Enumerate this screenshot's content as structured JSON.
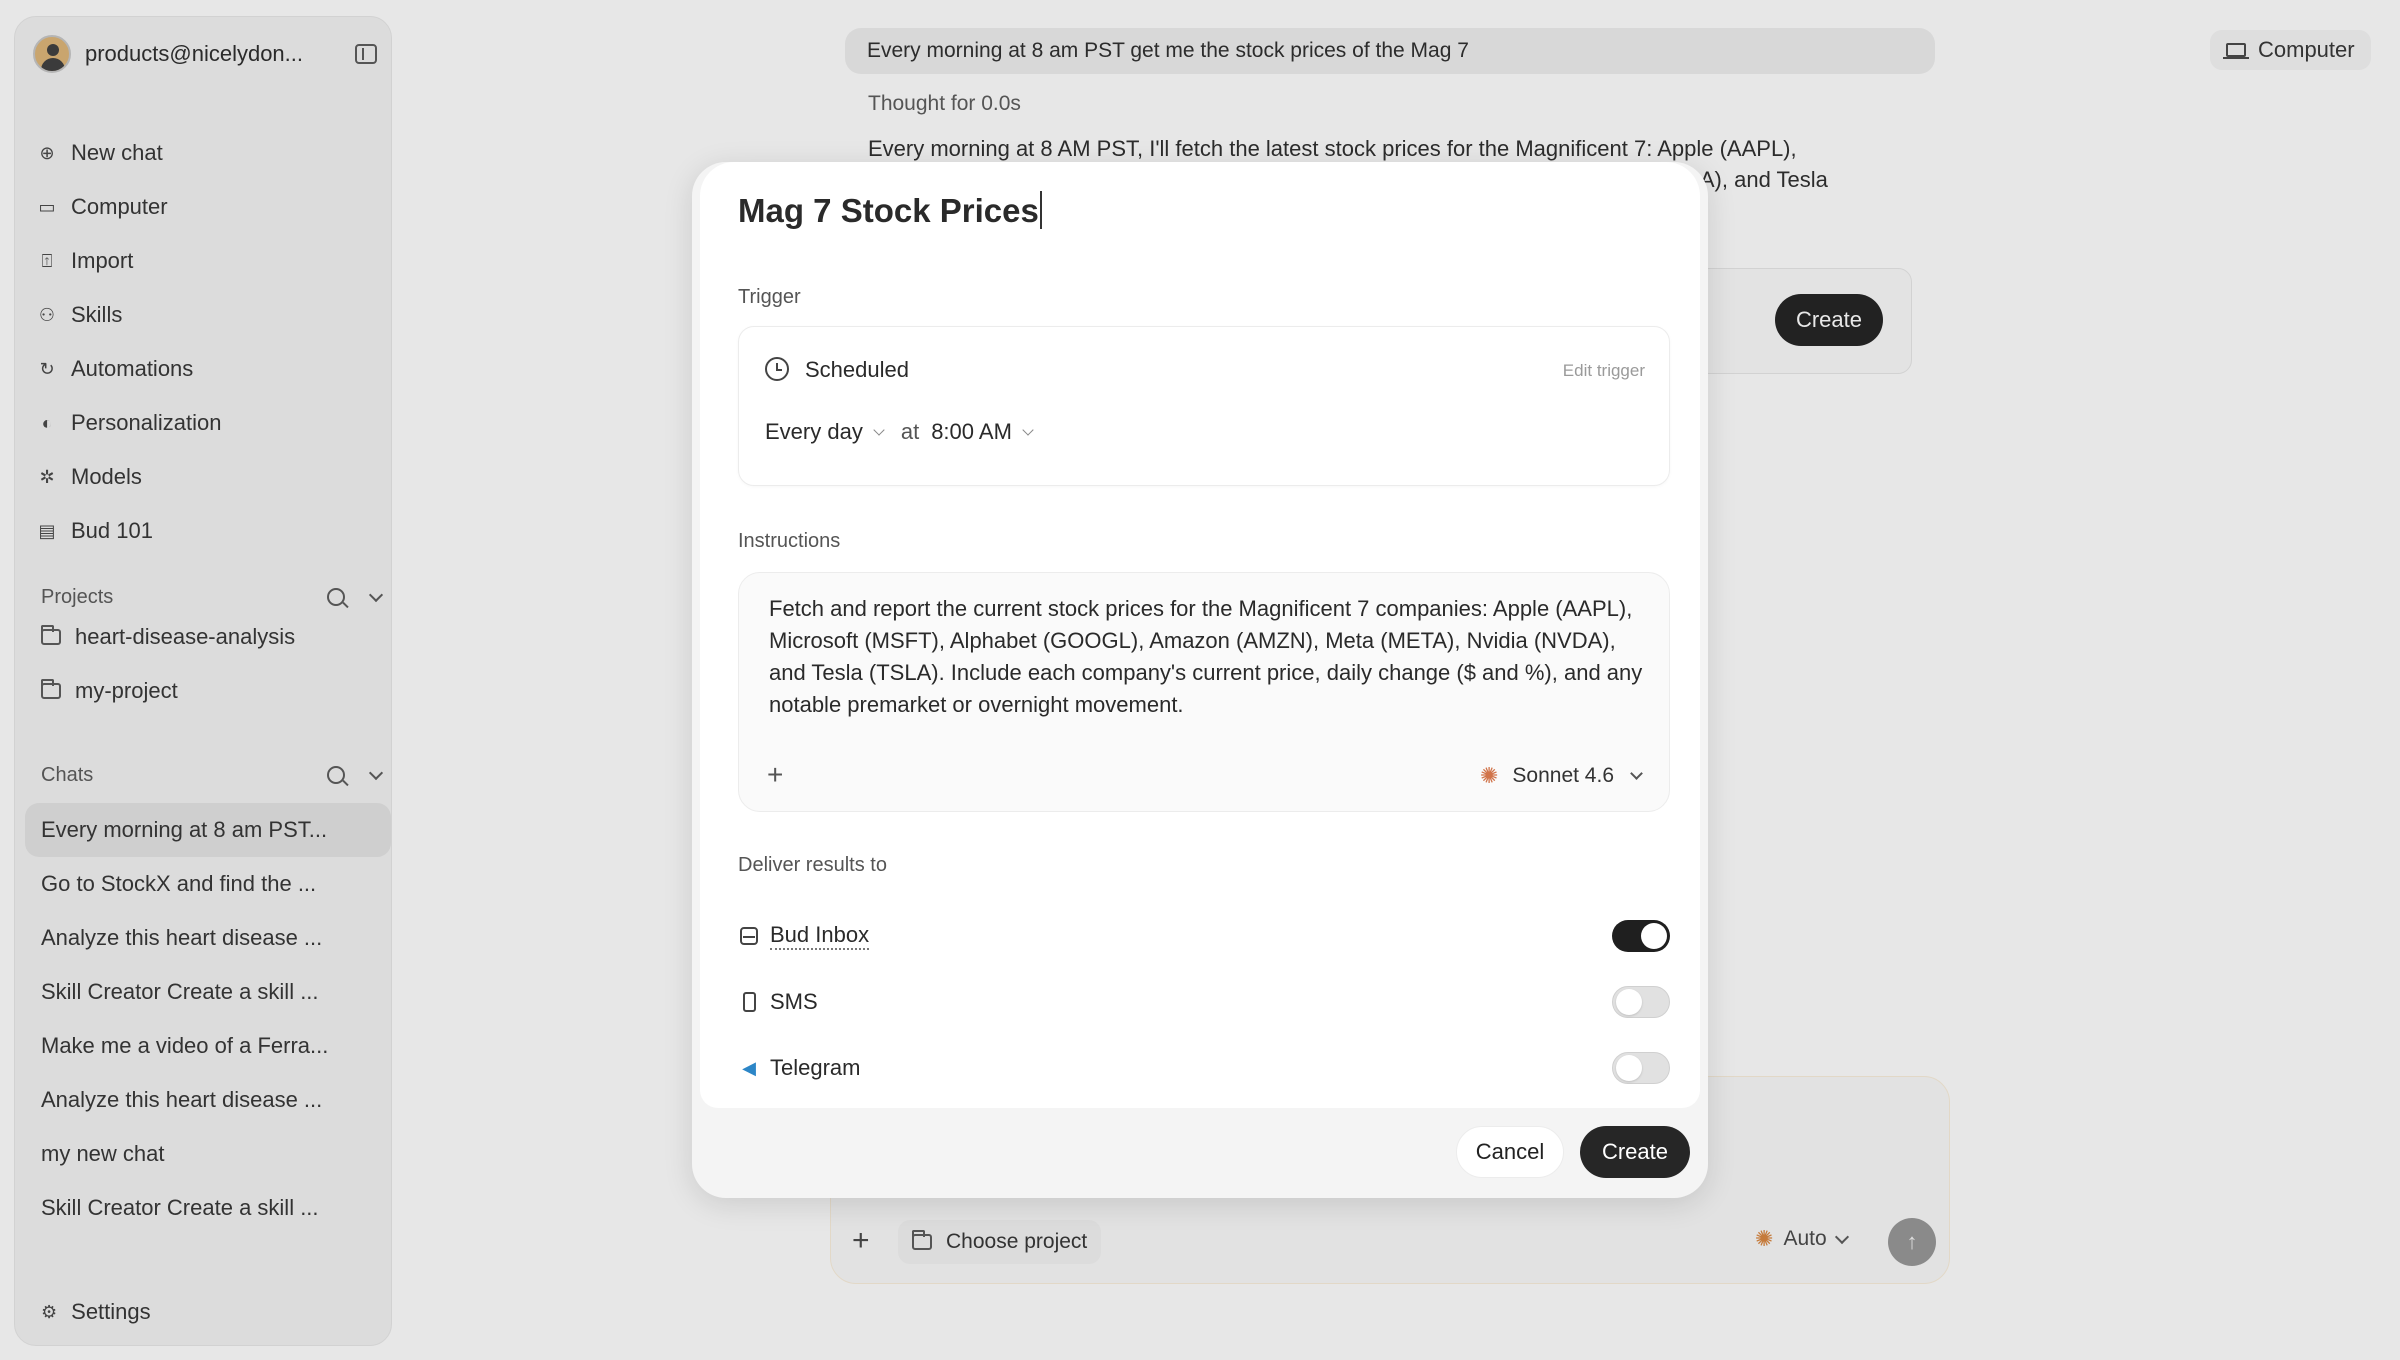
{
  "sidebar": {
    "email": "products@nicelydon...",
    "nav": [
      {
        "label": "New chat",
        "icon": "plus-circle-icon"
      },
      {
        "label": "Computer",
        "icon": "laptop-icon"
      },
      {
        "label": "Import",
        "icon": "import-icon"
      },
      {
        "label": "Skills",
        "icon": "skills-icon"
      },
      {
        "label": "Automations",
        "icon": "automations-icon"
      },
      {
        "label": "Personalization",
        "icon": "personalization-icon"
      },
      {
        "label": "Models",
        "icon": "models-icon"
      },
      {
        "label": "Bud 101",
        "icon": "book-icon"
      }
    ],
    "projects_label": "Projects",
    "projects": [
      "heart-disease-analysis",
      "my-project"
    ],
    "chats_label": "Chats",
    "chats": [
      "Every morning at 8 am PST...",
      "Go to StockX and find the ...",
      "Analyze this heart disease ...",
      "Skill Creator Create a skill ...",
      "Make me a video of a Ferra...",
      "Analyze this heart disease ...",
      "my new chat",
      "Skill Creator Create a skill ..."
    ],
    "settings_label": "Settings"
  },
  "main": {
    "prompt": "Every morning at 8 am PST get me the stock prices of the Mag 7",
    "thought": "Thought for 0.0s",
    "reply_line1": "Every morning at 8 AM PST, I'll fetch the latest stock prices for the Magnificent 7: Apple (AAPL),",
    "reply_line2": "DA), and Tesla",
    "card_create": "Create",
    "computer_button": "Computer",
    "composer": {
      "choose_project": "Choose project",
      "model": "Auto"
    }
  },
  "modal": {
    "title": "Mag 7 Stock Prices",
    "trigger_label": "Trigger",
    "trigger_type": "Scheduled",
    "edit_trigger": "Edit trigger",
    "frequency": "Every day",
    "at": "at",
    "time": "8:00 AM",
    "instructions_label": "Instructions",
    "instructions": "Fetch and report the current stock prices for the Magnificent 7 companies: Apple (AAPL), Microsoft (MSFT), Alphabet (GOOGL), Amazon (AMZN), Meta (META), Nvidia (NVDA), and Tesla (TSLA). Include each company's current price, daily change ($ and %), and any notable premarket or overnight movement.",
    "model": "Sonnet 4.6",
    "deliver_label": "Deliver results to",
    "deliver": [
      {
        "label": "Bud Inbox",
        "enabled": true
      },
      {
        "label": "SMS",
        "enabled": false
      },
      {
        "label": "Telegram",
        "enabled": false
      }
    ],
    "cancel": "Cancel",
    "create": "Create"
  }
}
